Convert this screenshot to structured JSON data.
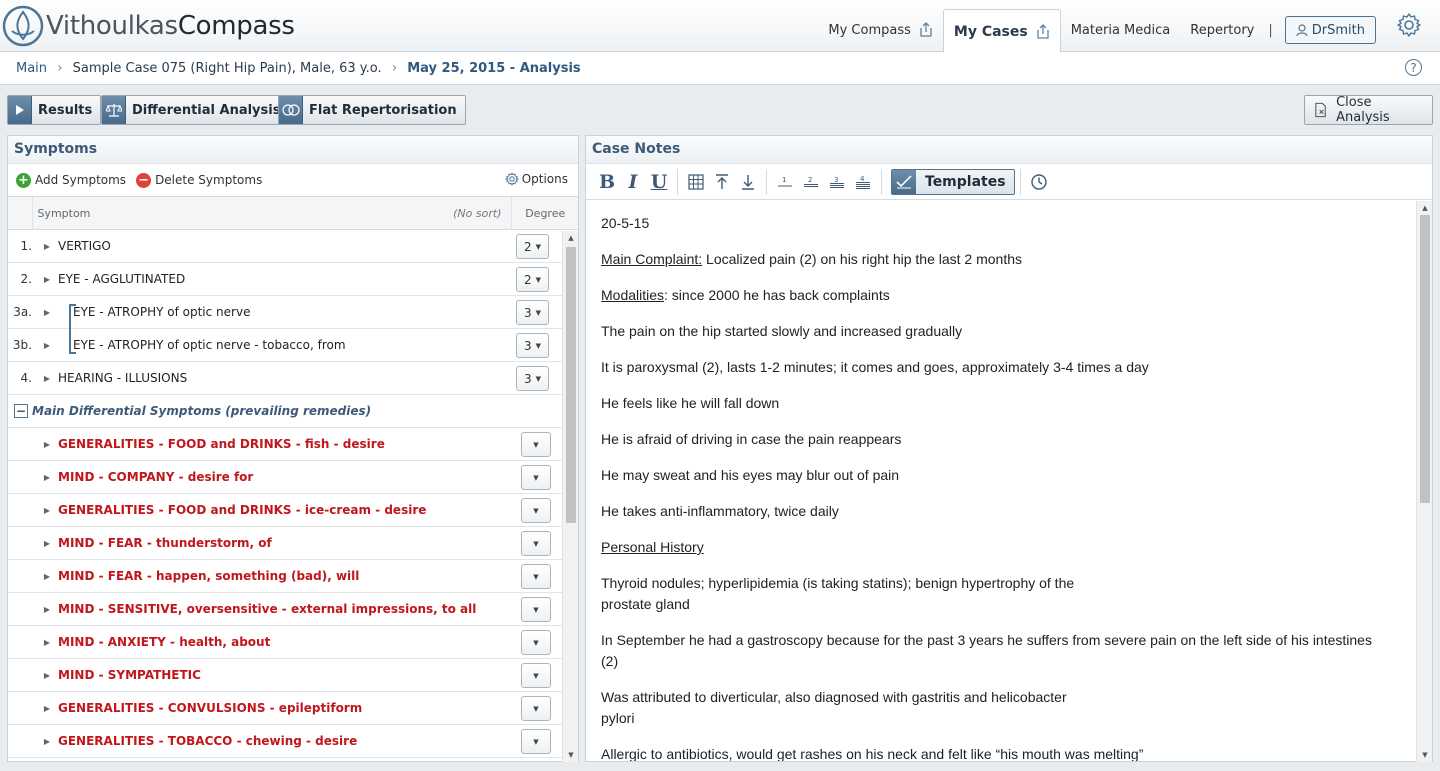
{
  "app": {
    "logo_text_a": "Vithoulkas",
    "logo_text_b": "Compass"
  },
  "nav": {
    "my_compass": "My Compass",
    "my_cases": "My Cases",
    "materia_medica": "Materia Medica",
    "repertory": "Repertory",
    "separator": "|",
    "user": "DrSmith"
  },
  "breadcrumb": {
    "main": "Main",
    "case": "Sample Case 075 (Right Hip Pain), Male, 63 y.o.",
    "analysis": "May 25, 2015 - Analysis"
  },
  "help_label": "?",
  "actions": {
    "results": "Results",
    "differential": "Differential Analysis",
    "flat": "Flat Repertorisation",
    "close": "Close Analysis"
  },
  "symptoms": {
    "title": "Symptoms",
    "add": "Add Symptoms",
    "delete": "Delete Symptoms",
    "options": "Options",
    "col_symptom": "Symptom",
    "col_sort": "(No sort)",
    "col_degree": "Degree",
    "items": [
      {
        "num": "1.",
        "text": "VERTIGO",
        "degree": "2"
      },
      {
        "num": "2.",
        "text": "EYE - AGGLUTINATED",
        "degree": "2"
      },
      {
        "num": "3a.",
        "text": "EYE - ATROPHY of optic nerve",
        "degree": "3"
      },
      {
        "num": "3b.",
        "text": "EYE - ATROPHY of optic nerve - tobacco, from",
        "degree": "3"
      },
      {
        "num": "4.",
        "text": "HEARING - ILLUSIONS",
        "degree": "3"
      }
    ],
    "group_label": "Main Differential Symptoms (prevailing remedies)",
    "group_items": [
      "GENERALITIES - FOOD and DRINKS - fish - desire",
      "MIND - COMPANY - desire for",
      "GENERALITIES - FOOD and DRINKS - ice-cream - desire",
      "MIND - FEAR - thunderstorm, of",
      "MIND - FEAR - happen, something (bad), will",
      "MIND - SENSITIVE, oversensitive - external impressions, to all",
      "MIND - ANXIETY - health, about",
      "MIND - SYMPATHETIC",
      "GENERALITIES - CONVULSIONS - epileptiform",
      "GENERALITIES - TOBACCO - chewing - desire"
    ]
  },
  "notes": {
    "title": "Case Notes",
    "templates": "Templates",
    "date": "20-5-15",
    "main_label": "Main Complaint:",
    "main_text": " Localized pain (2) on his right hip the last 2 months",
    "mod_label": "Modalities",
    "mod_text": ": since 2000 he has back complaints",
    "p1": "The pain on the hip started slowly and increased gradually",
    "p2": "It is paroxysmal (2), lasts 1-2 minutes; it comes and goes, approximately 3-4 times a day",
    "p3": "He feels like he will fall down",
    "p4": "He is afraid of driving in case the pain reappears",
    "p5": "He may sweat and his eyes may blur out of pain",
    "p6": "He takes anti-inflammatory, twice daily",
    "personal_label": "Personal History",
    "p7a": "Thyroid nodules; hyperlipidemia (is taking statins); benign hypertrophy of the",
    "p7b": "prostate gland",
    "p8": "In September he had a gastroscopy because for the past 3 years he suffers from severe pain on the left side of his intestines (2)",
    "p9a": "Was attributed to diverticular, also diagnosed with gastritis and helicobacter",
    "p9b": "pylori",
    "p10": "Allergic to antibiotics, would get rashes on his neck and felt like “his mouth was melting”"
  },
  "colors": {
    "accent": "#3d5a78",
    "red_symptom": "#c0171c",
    "add_green": "#3aa335",
    "delete_red": "#e0413a"
  }
}
